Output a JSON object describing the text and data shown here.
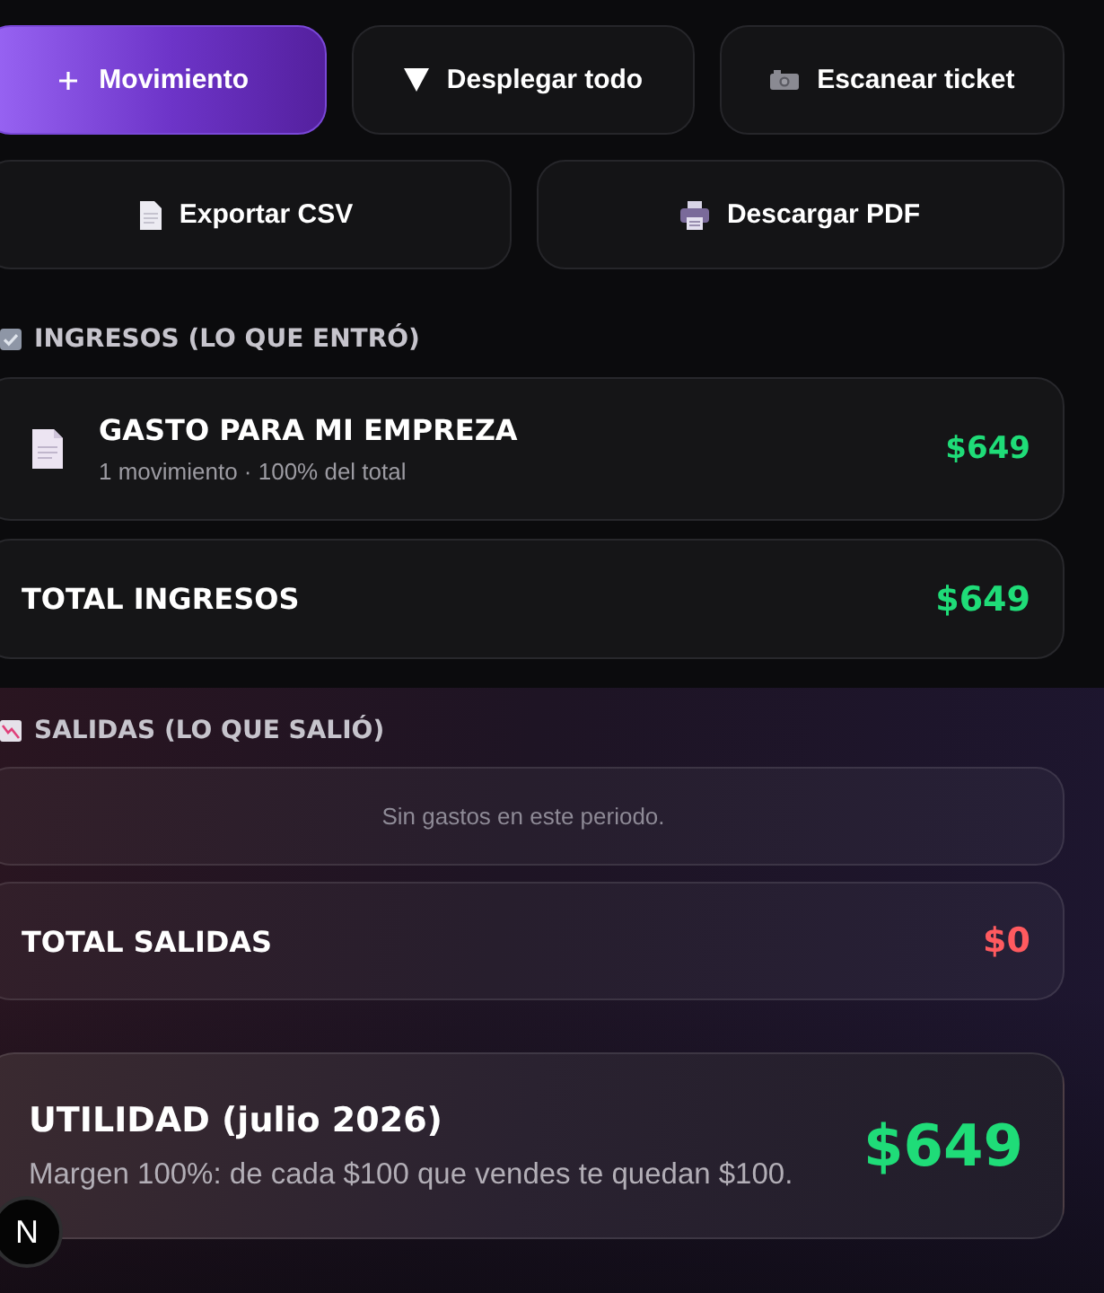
{
  "toolbar": {
    "buttons": [
      {
        "kind": "add",
        "label": "Movimiento"
      },
      {
        "kind": "expand",
        "label": "Desplegar todo"
      },
      {
        "kind": "scan",
        "label": "Escanear ticket"
      }
    ]
  },
  "export_buttons": [
    {
      "kind": "csv",
      "label": "Exportar CSV"
    },
    {
      "kind": "pdf",
      "label": "Descargar PDF"
    }
  ],
  "income": {
    "kind": "income",
    "title": "INGRESOS (LO QUE ENTRÓ)",
    "items": [
      {
        "title": "GASTO PARA MI EMPREZA",
        "subtitle": "1 movimiento · 100% del total",
        "amount": "$649"
      }
    ],
    "total": {
      "label": "TOTAL INGRESOS",
      "amount": "$649"
    }
  },
  "expenses": {
    "kind": "expense",
    "title": "SALIDAS (LO QUE SALIÓ)",
    "empty_message": "Sin gastos en este periodo.",
    "total": {
      "label": "TOTAL SALIDAS",
      "amount": "$0"
    }
  },
  "summary": {
    "title": "UTILIDAD (julio 2026)",
    "note": "Margen 100%: de cada $100 que vendes te quedan $100.",
    "amount": "$649"
  },
  "dev_badge": {
    "label": "N"
  }
}
